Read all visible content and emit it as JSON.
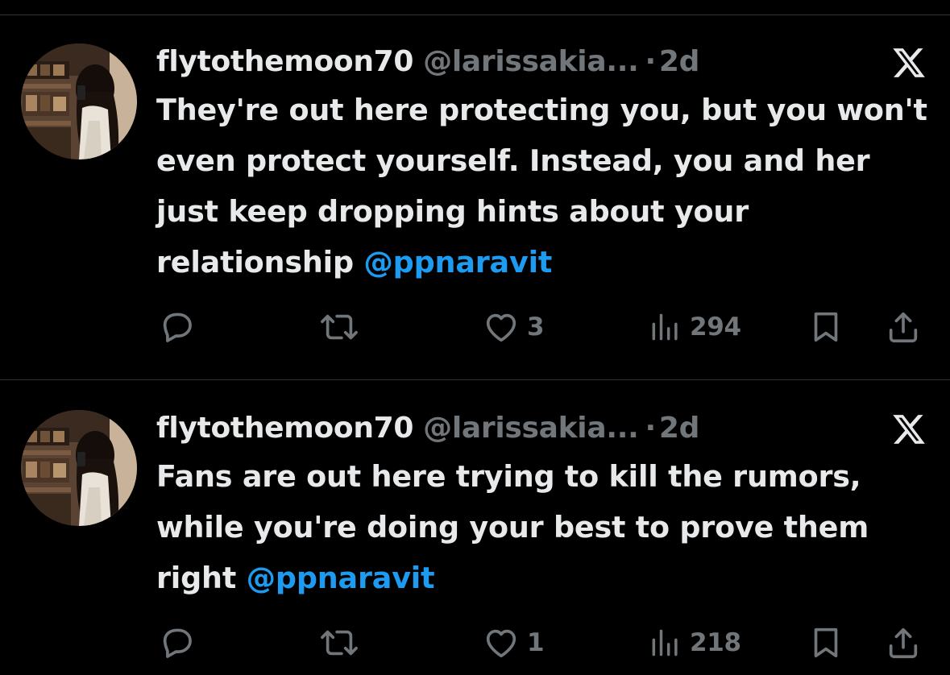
{
  "tweets": [
    {
      "display_name": "flytothemoon70",
      "handle": "@larissakia...",
      "separator": "·",
      "time": "2d",
      "text": "They're out here protecting you, but you won't even protect yourself. Instead, you and her just keep dropping hints about your relationship ",
      "mention": "@ppnaravit",
      "likes": "3",
      "views": "294"
    },
    {
      "display_name": "flytothemoon70",
      "handle": "@larissakia...",
      "separator": "·",
      "time": "2d",
      "text": "Fans are out here trying to kill the rumors, while you're doing your best to prove them right ",
      "mention": "@ppnaravit",
      "likes": "1",
      "views": "218"
    }
  ],
  "icons": {
    "reply": "reply-icon",
    "retweet": "retweet-icon",
    "like": "heart-icon",
    "views": "views-icon",
    "bookmark": "bookmark-icon",
    "share": "share-icon",
    "platform": "x-logo-icon"
  },
  "colors": {
    "background": "#000000",
    "text": "#e7e9ea",
    "secondary": "#71767b",
    "mention": "#1d9bf0",
    "divider": "#2f3336"
  }
}
